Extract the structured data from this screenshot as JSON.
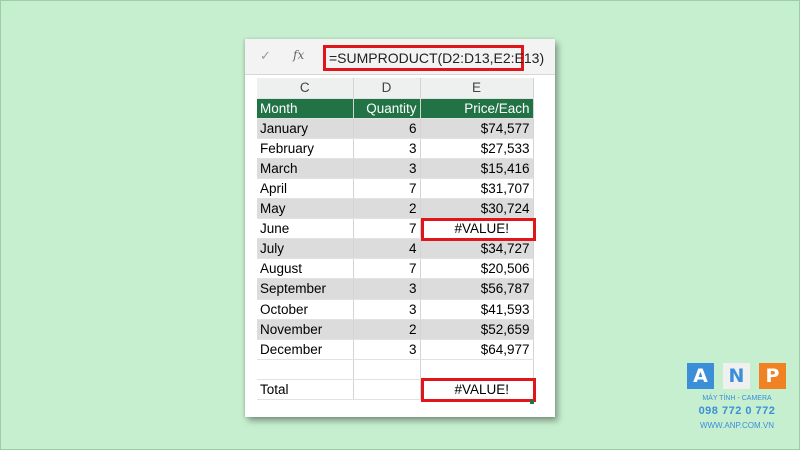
{
  "formula_bar": {
    "check_icon": "✓",
    "fx_icon": "fx",
    "formula": "=SUMPRODUCT(D2:D13,E2:E13)"
  },
  "column_headers": [
    "C",
    "D",
    "E"
  ],
  "table_header": {
    "month": "Month",
    "quantity": "Quantity",
    "price": "Price/Each"
  },
  "rows": [
    {
      "month": "January",
      "qty": "6",
      "price": "$74,577"
    },
    {
      "month": "February",
      "qty": "3",
      "price": "$27,533"
    },
    {
      "month": "March",
      "qty": "3",
      "price": "$15,416"
    },
    {
      "month": "April",
      "qty": "7",
      "price": "$31,707"
    },
    {
      "month": "May",
      "qty": "2",
      "price": "$30,724"
    },
    {
      "month": "June",
      "qty": "7",
      "price": "#VALUE!"
    },
    {
      "month": "July",
      "qty": "4",
      "price": "$34,727"
    },
    {
      "month": "August",
      "qty": "7",
      "price": "$20,506"
    },
    {
      "month": "September",
      "qty": "3",
      "price": "$56,787"
    },
    {
      "month": "October",
      "qty": "3",
      "price": "$41,593"
    },
    {
      "month": "November",
      "qty": "2",
      "price": "$52,659"
    },
    {
      "month": "December",
      "qty": "3",
      "price": "$64,977"
    }
  ],
  "total": {
    "label": "Total",
    "value": "#VALUE!"
  },
  "colors": {
    "header_green": "#217346",
    "highlight_red": "#e0161a",
    "background": "#c6efcf"
  },
  "logo": {
    "letter_a": "A",
    "letter_n": "N",
    "letter_p": "P",
    "tagline": "MÁY TÍNH - CAMERA",
    "phone": "098 772 0 772",
    "website": "WWW.ANP.COM.VN"
  }
}
